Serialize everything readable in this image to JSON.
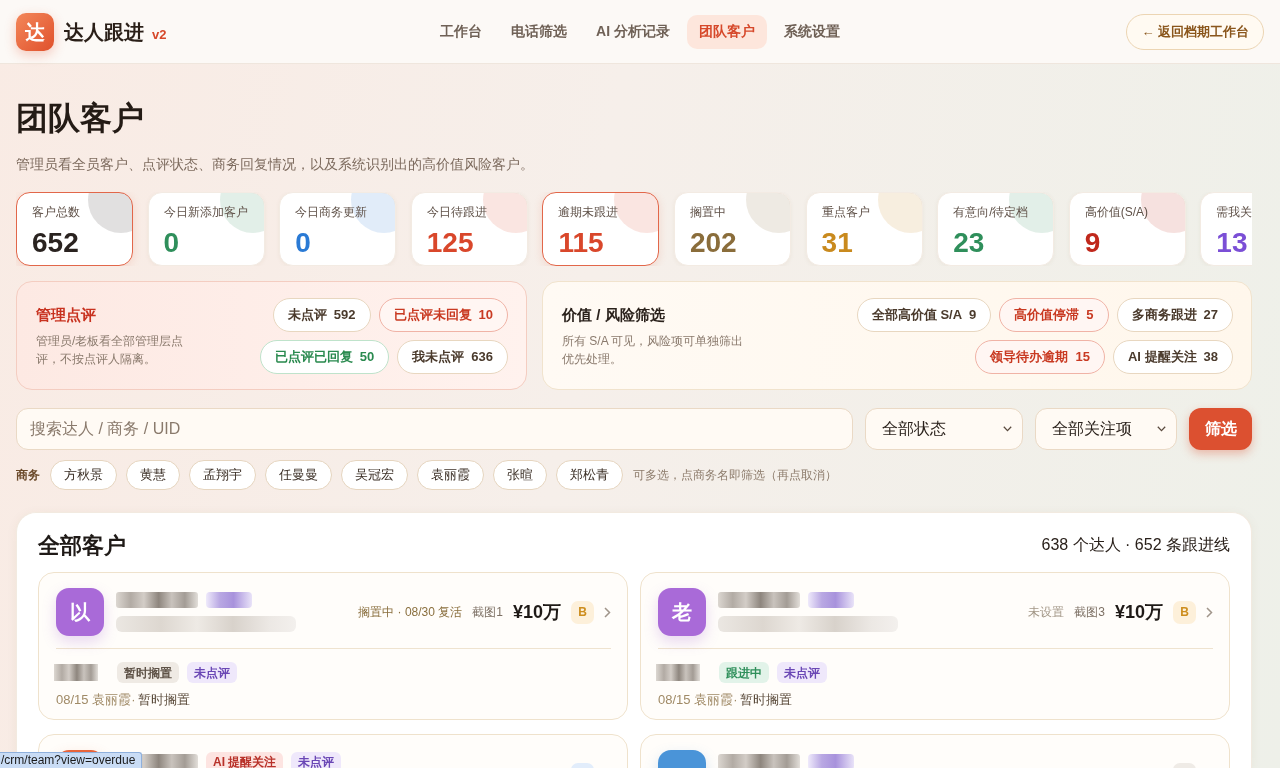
{
  "header": {
    "logo_char": "达",
    "title": "达人跟进",
    "version": "v2",
    "nav": [
      {
        "label": "工作台",
        "selected": false
      },
      {
        "label": "电话筛选",
        "selected": false
      },
      {
        "label": "AI 分析记录",
        "selected": false
      },
      {
        "label": "团队客户",
        "selected": true
      },
      {
        "label": "系统设置",
        "selected": false
      }
    ],
    "back_button": "← 返回档期工作台"
  },
  "page": {
    "title": "团队客户",
    "subtitle": "管理员看全员客户、点评状态、商务回复情况，以及系统识别出的高价值风险客户。"
  },
  "stats": [
    {
      "label": "客户总数",
      "value": "652",
      "color": "#2a2320",
      "selected": true
    },
    {
      "label": "今日新添加客户",
      "value": "0",
      "color": "#2f8f5b",
      "selected": false
    },
    {
      "label": "今日商务更新",
      "value": "0",
      "color": "#2a7ad5",
      "selected": false
    },
    {
      "label": "今日待跟进",
      "value": "125",
      "color": "#d9472b",
      "selected": false
    },
    {
      "label": "逾期未跟进",
      "value": "115",
      "color": "#d9472b",
      "selected": true
    },
    {
      "label": "搁置中",
      "value": "202",
      "color": "#8a6d3b",
      "selected": false
    },
    {
      "label": "重点客户",
      "value": "31",
      "color": "#c98a1e",
      "selected": false
    },
    {
      "label": "有意向/待定档",
      "value": "23",
      "color": "#2f8f5b",
      "selected": false
    },
    {
      "label": "高价值(S/A)",
      "value": "9",
      "color": "#c0281c",
      "selected": false
    },
    {
      "label": "需我关",
      "value": "13",
      "color": "#7b4fd6",
      "selected": false
    }
  ],
  "review_panel": {
    "title": "管理点评",
    "description": "管理员/老板看全部管理层点评，不按点评人隔离。",
    "chip_rows": [
      [
        {
          "label": "未点评",
          "count": "592",
          "kind": "neutral"
        },
        {
          "label": "已点评未回复",
          "count": "10",
          "kind": "danger"
        }
      ],
      [
        {
          "label": "已点评已回复",
          "count": "50",
          "kind": "success"
        },
        {
          "label": "我未点评",
          "count": "636",
          "kind": "neutral"
        }
      ]
    ]
  },
  "risk_panel": {
    "title": "价值 / 风险筛选",
    "description": "所有 S/A 可见，风险项可单独筛出优先处理。",
    "chip_rows": [
      [
        {
          "label": "全部高价值 S/A",
          "count": "9",
          "kind": "neutral"
        },
        {
          "label": "高价值停滞",
          "count": "5",
          "kind": "danger"
        },
        {
          "label": "多商务跟进",
          "count": "27",
          "kind": "neutral"
        }
      ],
      [
        {
          "label": "领导待办逾期",
          "count": "15",
          "kind": "danger"
        },
        {
          "label": "AI 提醒关注",
          "count": "38",
          "kind": "neutral"
        }
      ]
    ]
  },
  "search": {
    "placeholder": "搜索达人 / 商务 / UID",
    "status_select": "全部状态",
    "focus_select": "全部关注项",
    "submit": "筛选"
  },
  "owners": {
    "label": "商务",
    "items": [
      {
        "label": "方秋景",
        "selected": false
      },
      {
        "label": "黄慧",
        "selected": false
      },
      {
        "label": "孟翔宇",
        "selected": false
      },
      {
        "label": "任曼曼",
        "selected": false
      },
      {
        "label": "吴冠宏",
        "selected": false
      },
      {
        "label": "袁丽霞",
        "selected": false
      },
      {
        "label": "张暄",
        "selected": false
      },
      {
        "label": "郑松青",
        "selected": false
      }
    ],
    "hint": "可多选，点商务名即筛选（再点取消）"
  },
  "customers": {
    "title": "全部客户",
    "summary": "638 个达人 · 652 条跟进线",
    "cards": [
      {
        "avatar": "以",
        "color": "#a96ad8",
        "name_tag_pixelated": true,
        "status": {
          "label": "搁置中 · 08/30 复活",
          "color": "#8a6f3e"
        },
        "screenshots": "截图1",
        "amount": "¥10万",
        "grade": {
          "label": "B",
          "color": "#fdf0da"
        },
        "tags": [
          {
            "label": "暂时搁置",
            "kind": "paused"
          },
          {
            "label": "未点评",
            "kind": "review"
          }
        ],
        "note_meta": "08/15 袁丽霞·",
        "note_text": "暂时搁置"
      },
      {
        "avatar": "老",
        "color": "#a96ad8",
        "name_tag_pixelated": true,
        "status": {
          "label": "未设置",
          "color": "#a39787"
        },
        "screenshots": "截图3",
        "amount": "¥10万",
        "grade": {
          "label": "B",
          "color": "#fdf0da"
        },
        "tags": [
          {
            "label": "跟进中",
            "kind": "active"
          },
          {
            "label": "未点评",
            "kind": "review"
          }
        ],
        "note_meta": "08/15 袁丽霞·",
        "note_text": "暂时搁置"
      },
      {
        "color": "#e8643b",
        "name_tag_pixelated": false,
        "top_tags": [
          {
            "label": "AI 提醒关注",
            "kind": "alert"
          },
          {
            "label": "未点评",
            "kind": "review"
          }
        ],
        "grade": {
          "color": "#e2edfb"
        }
      },
      {
        "color": "#4a94d8",
        "name_tag_pixelated": true,
        "grade": {
          "color": "#efebe6"
        }
      }
    ]
  },
  "browser_status_url": "/crm/team?view=overdue"
}
